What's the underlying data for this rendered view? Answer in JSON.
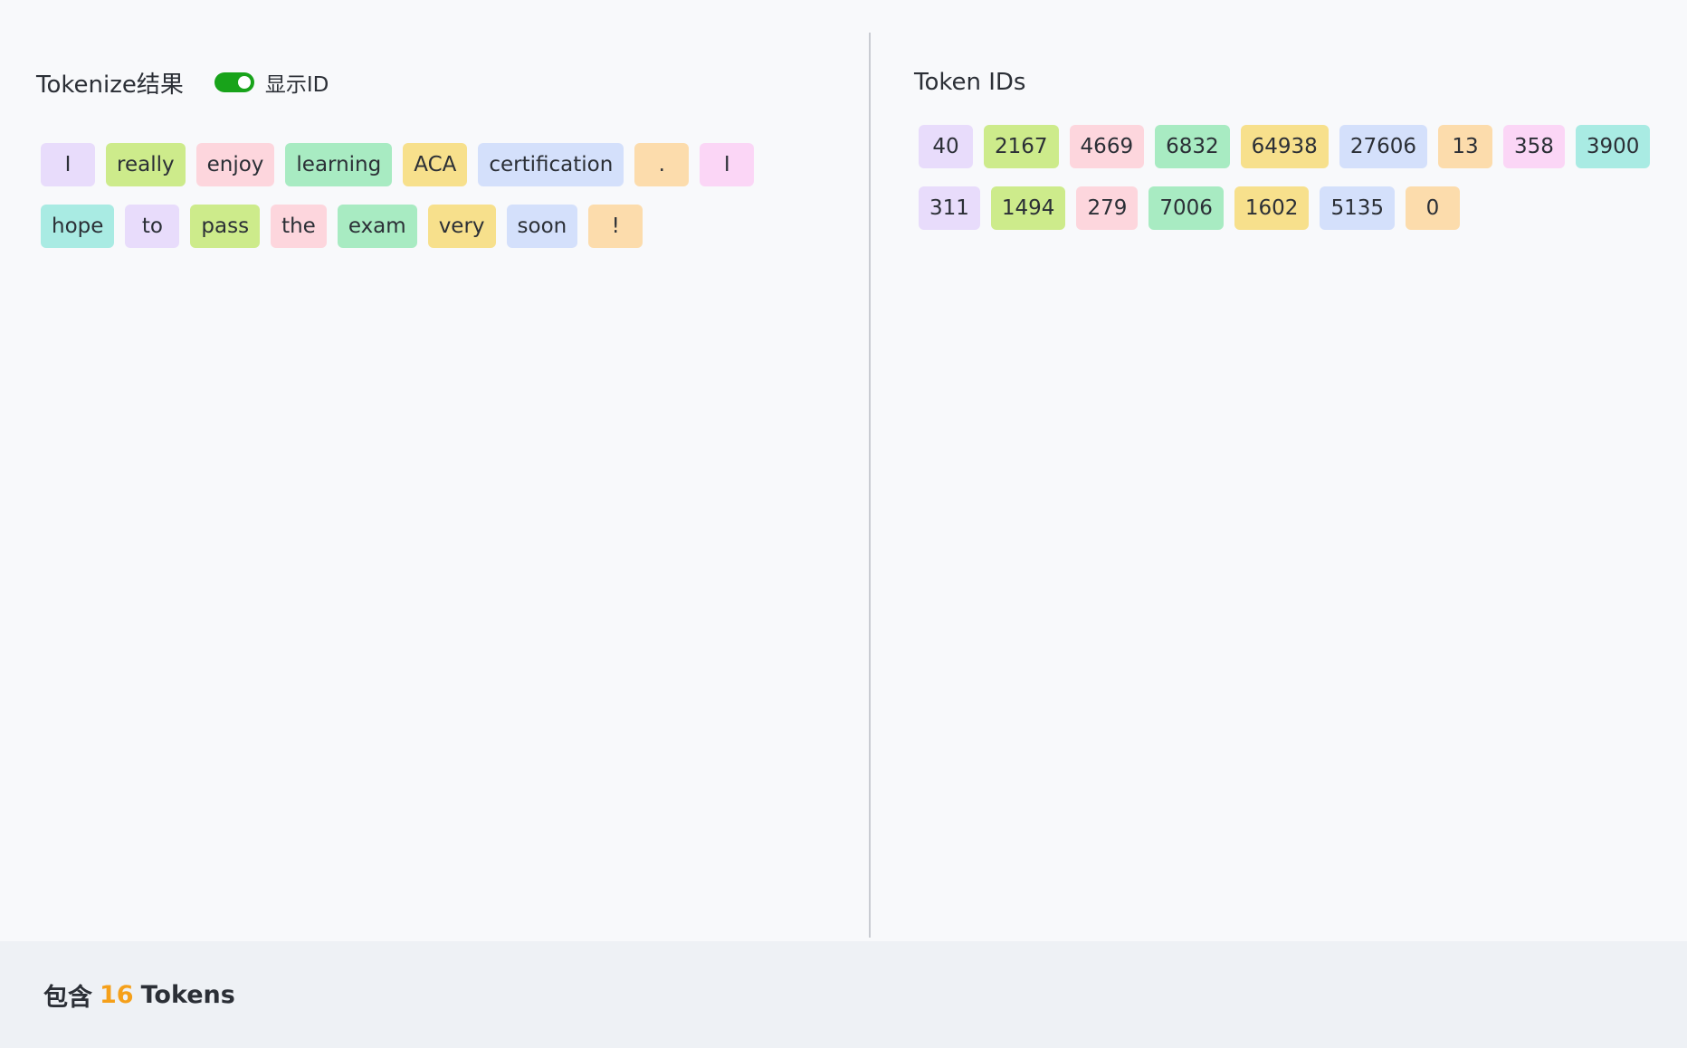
{
  "left_panel": {
    "title": "Tokenize结果",
    "show_id_label": "显示ID",
    "show_id_enabled": true,
    "tokens": [
      {
        "text": "I",
        "color": "#e8dcfb"
      },
      {
        "text": "really",
        "color": "#cdeb8b"
      },
      {
        "text": "enjoy",
        "color": "#fdd6dd"
      },
      {
        "text": "learning",
        "color": "#a8ebc2"
      },
      {
        "text": "ACA",
        "color": "#f7e08c"
      },
      {
        "text": "certification",
        "color": "#d4e0fb"
      },
      {
        "text": ".",
        "color": "#fcdcac"
      },
      {
        "text": "I",
        "color": "#fbd6f6"
      },
      {
        "text": "hope",
        "color": "#a9ebe3"
      },
      {
        "text": "to",
        "color": "#e8dcfb"
      },
      {
        "text": "pass",
        "color": "#cdeb8b"
      },
      {
        "text": "the",
        "color": "#fdd6dd"
      },
      {
        "text": "exam",
        "color": "#a8ebc2"
      },
      {
        "text": "very",
        "color": "#f7e08c"
      },
      {
        "text": "soon",
        "color": "#d4e0fb"
      },
      {
        "text": "!",
        "color": "#fcdcac"
      }
    ]
  },
  "right_panel": {
    "title": "Token IDs",
    "ids": [
      {
        "text": "40",
        "color": "#e8dcfb"
      },
      {
        "text": "2167",
        "color": "#cdeb8b"
      },
      {
        "text": "4669",
        "color": "#fdd6dd"
      },
      {
        "text": "6832",
        "color": "#a8ebc2"
      },
      {
        "text": "64938",
        "color": "#f7e08c"
      },
      {
        "text": "27606",
        "color": "#d4e0fb"
      },
      {
        "text": "13",
        "color": "#fcdcac"
      },
      {
        "text": "358",
        "color": "#fbd6f6"
      },
      {
        "text": "3900",
        "color": "#a9ebe3"
      },
      {
        "text": "311",
        "color": "#e8dcfb"
      },
      {
        "text": "1494",
        "color": "#cdeb8b"
      },
      {
        "text": "279",
        "color": "#fdd6dd"
      },
      {
        "text": "7006",
        "color": "#a8ebc2"
      },
      {
        "text": "1602",
        "color": "#f7e08c"
      },
      {
        "text": "5135",
        "color": "#d4e0fb"
      },
      {
        "text": "0",
        "color": "#fcdcac"
      }
    ]
  },
  "footer": {
    "prefix": "包含",
    "count": "16",
    "suffix": "Tokens"
  },
  "colors": {
    "switch_on": "#18a31a",
    "count_accent": "#f5a01a"
  }
}
